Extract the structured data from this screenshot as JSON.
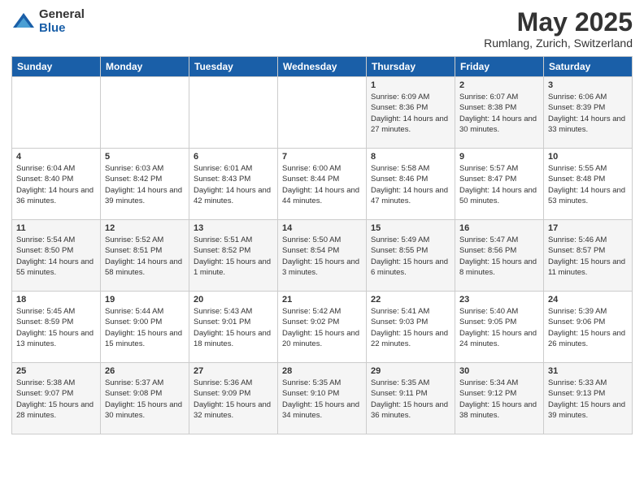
{
  "logo": {
    "general": "General",
    "blue": "Blue"
  },
  "title": "May 2025",
  "location": "Rumlang, Zurich, Switzerland",
  "weekdays": [
    "Sunday",
    "Monday",
    "Tuesday",
    "Wednesday",
    "Thursday",
    "Friday",
    "Saturday"
  ],
  "weeks": [
    [
      {
        "day": "",
        "info": ""
      },
      {
        "day": "",
        "info": ""
      },
      {
        "day": "",
        "info": ""
      },
      {
        "day": "",
        "info": ""
      },
      {
        "day": "1",
        "info": "Sunrise: 6:09 AM\nSunset: 8:36 PM\nDaylight: 14 hours\nand 27 minutes."
      },
      {
        "day": "2",
        "info": "Sunrise: 6:07 AM\nSunset: 8:38 PM\nDaylight: 14 hours\nand 30 minutes."
      },
      {
        "day": "3",
        "info": "Sunrise: 6:06 AM\nSunset: 8:39 PM\nDaylight: 14 hours\nand 33 minutes."
      }
    ],
    [
      {
        "day": "4",
        "info": "Sunrise: 6:04 AM\nSunset: 8:40 PM\nDaylight: 14 hours\nand 36 minutes."
      },
      {
        "day": "5",
        "info": "Sunrise: 6:03 AM\nSunset: 8:42 PM\nDaylight: 14 hours\nand 39 minutes."
      },
      {
        "day": "6",
        "info": "Sunrise: 6:01 AM\nSunset: 8:43 PM\nDaylight: 14 hours\nand 42 minutes."
      },
      {
        "day": "7",
        "info": "Sunrise: 6:00 AM\nSunset: 8:44 PM\nDaylight: 14 hours\nand 44 minutes."
      },
      {
        "day": "8",
        "info": "Sunrise: 5:58 AM\nSunset: 8:46 PM\nDaylight: 14 hours\nand 47 minutes."
      },
      {
        "day": "9",
        "info": "Sunrise: 5:57 AM\nSunset: 8:47 PM\nDaylight: 14 hours\nand 50 minutes."
      },
      {
        "day": "10",
        "info": "Sunrise: 5:55 AM\nSunset: 8:48 PM\nDaylight: 14 hours\nand 53 minutes."
      }
    ],
    [
      {
        "day": "11",
        "info": "Sunrise: 5:54 AM\nSunset: 8:50 PM\nDaylight: 14 hours\nand 55 minutes."
      },
      {
        "day": "12",
        "info": "Sunrise: 5:52 AM\nSunset: 8:51 PM\nDaylight: 14 hours\nand 58 minutes."
      },
      {
        "day": "13",
        "info": "Sunrise: 5:51 AM\nSunset: 8:52 PM\nDaylight: 15 hours\nand 1 minute."
      },
      {
        "day": "14",
        "info": "Sunrise: 5:50 AM\nSunset: 8:54 PM\nDaylight: 15 hours\nand 3 minutes."
      },
      {
        "day": "15",
        "info": "Sunrise: 5:49 AM\nSunset: 8:55 PM\nDaylight: 15 hours\nand 6 minutes."
      },
      {
        "day": "16",
        "info": "Sunrise: 5:47 AM\nSunset: 8:56 PM\nDaylight: 15 hours\nand 8 minutes."
      },
      {
        "day": "17",
        "info": "Sunrise: 5:46 AM\nSunset: 8:57 PM\nDaylight: 15 hours\nand 11 minutes."
      }
    ],
    [
      {
        "day": "18",
        "info": "Sunrise: 5:45 AM\nSunset: 8:59 PM\nDaylight: 15 hours\nand 13 minutes."
      },
      {
        "day": "19",
        "info": "Sunrise: 5:44 AM\nSunset: 9:00 PM\nDaylight: 15 hours\nand 15 minutes."
      },
      {
        "day": "20",
        "info": "Sunrise: 5:43 AM\nSunset: 9:01 PM\nDaylight: 15 hours\nand 18 minutes."
      },
      {
        "day": "21",
        "info": "Sunrise: 5:42 AM\nSunset: 9:02 PM\nDaylight: 15 hours\nand 20 minutes."
      },
      {
        "day": "22",
        "info": "Sunrise: 5:41 AM\nSunset: 9:03 PM\nDaylight: 15 hours\nand 22 minutes."
      },
      {
        "day": "23",
        "info": "Sunrise: 5:40 AM\nSunset: 9:05 PM\nDaylight: 15 hours\nand 24 minutes."
      },
      {
        "day": "24",
        "info": "Sunrise: 5:39 AM\nSunset: 9:06 PM\nDaylight: 15 hours\nand 26 minutes."
      }
    ],
    [
      {
        "day": "25",
        "info": "Sunrise: 5:38 AM\nSunset: 9:07 PM\nDaylight: 15 hours\nand 28 minutes."
      },
      {
        "day": "26",
        "info": "Sunrise: 5:37 AM\nSunset: 9:08 PM\nDaylight: 15 hours\nand 30 minutes."
      },
      {
        "day": "27",
        "info": "Sunrise: 5:36 AM\nSunset: 9:09 PM\nDaylight: 15 hours\nand 32 minutes."
      },
      {
        "day": "28",
        "info": "Sunrise: 5:35 AM\nSunset: 9:10 PM\nDaylight: 15 hours\nand 34 minutes."
      },
      {
        "day": "29",
        "info": "Sunrise: 5:35 AM\nSunset: 9:11 PM\nDaylight: 15 hours\nand 36 minutes."
      },
      {
        "day": "30",
        "info": "Sunrise: 5:34 AM\nSunset: 9:12 PM\nDaylight: 15 hours\nand 38 minutes."
      },
      {
        "day": "31",
        "info": "Sunrise: 5:33 AM\nSunset: 9:13 PM\nDaylight: 15 hours\nand 39 minutes."
      }
    ]
  ]
}
